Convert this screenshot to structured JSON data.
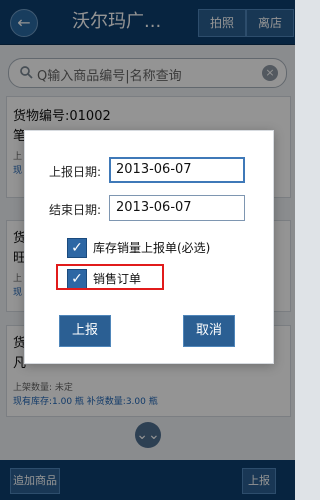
{
  "header": {
    "back_icon": "back-arrow-icon",
    "title": "沃尔玛广...",
    "photo_label": "拍照",
    "store_label": "离店"
  },
  "search": {
    "placeholder": "Q输入商品编号|名称查询"
  },
  "cards": [
    {
      "line1": "货物编号:01002",
      "line2": "笔",
      "sub1": "上",
      "sub2": "现"
    },
    {
      "line1": "货",
      "line2": "旺",
      "sub1": "上",
      "sub2": "现"
    },
    {
      "line1": "货",
      "line2": "凡",
      "sub1": "上架数量: 未定",
      "sub2": "现有库存:1.00 瓶  补货数量:3.00 瓶"
    }
  ],
  "footer": {
    "add_label": "追加商品",
    "submit_label": "上报"
  },
  "dialog": {
    "report_date_label": "上报日期:",
    "report_date_value": "2013-06-07",
    "end_date_label": "结束日期:",
    "end_date_value": "2013-06-07",
    "inventory_check_label": "库存销量上报单(必选)",
    "sales_order_label": "销售订单",
    "ok_label": "上报",
    "cancel_label": "取消"
  }
}
